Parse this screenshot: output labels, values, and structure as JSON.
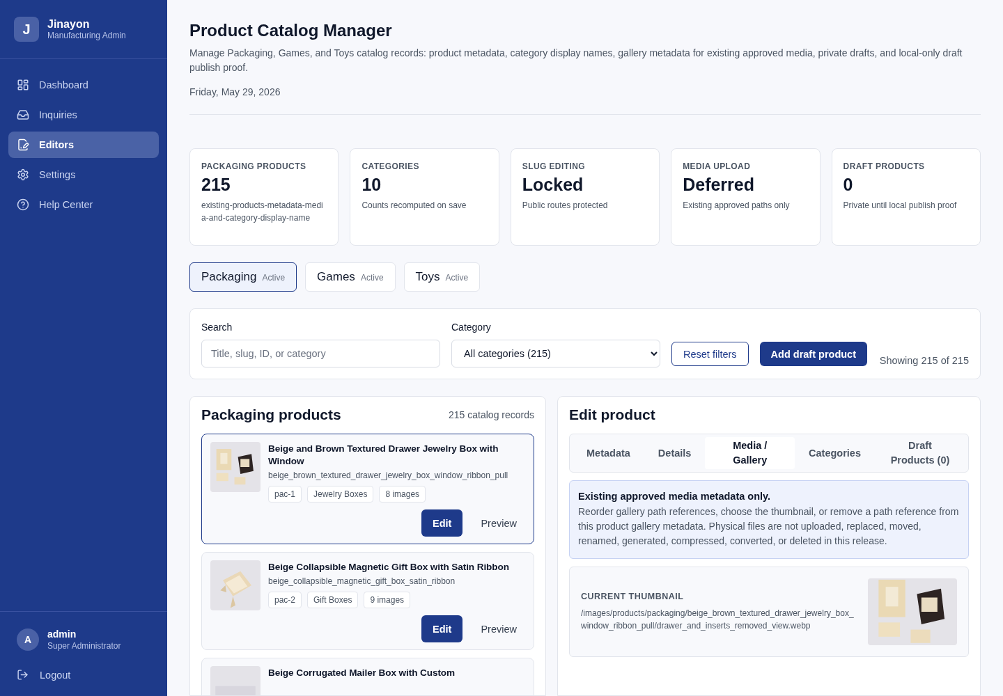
{
  "brand": {
    "initial": "J",
    "name": "Jinayon",
    "subtitle": "Manufacturing Admin"
  },
  "nav": [
    {
      "label": "Dashboard",
      "selected": false
    },
    {
      "label": "Inquiries",
      "selected": false
    },
    {
      "label": "Editors",
      "selected": true
    },
    {
      "label": "Settings",
      "selected": false
    },
    {
      "label": "Help Center",
      "selected": false
    }
  ],
  "user": {
    "initial": "A",
    "name": "admin",
    "role": "Super Administrator"
  },
  "logout": "Logout",
  "header": {
    "title": "Product Catalog Manager",
    "description": "Manage Packaging, Games, and Toys catalog records: product metadata, category display names, gallery metadata for existing approved media, private drafts, and local-only draft publish proof.",
    "date": "Friday, May 29, 2026"
  },
  "stats": [
    {
      "label": "PACKAGING PRODUCTS",
      "value": "215",
      "note": "existing-products-metadata-media-and-category-display-name"
    },
    {
      "label": "CATEGORIES",
      "value": "10",
      "note": "Counts recomputed on save"
    },
    {
      "label": "SLUG EDITING",
      "value": "Locked",
      "note": "Public routes protected"
    },
    {
      "label": "MEDIA UPLOAD",
      "value": "Deferred",
      "note": "Existing approved paths only"
    },
    {
      "label": "DRAFT PRODUCTS",
      "value": "0",
      "note": "Private until local publish proof"
    }
  ],
  "catalog_tabs": [
    {
      "label": "Packaging",
      "badge": "Active",
      "selected": true
    },
    {
      "label": "Games",
      "badge": "Active",
      "selected": false
    },
    {
      "label": "Toys",
      "badge": "Active",
      "selected": false
    }
  ],
  "filters": {
    "search_label": "Search",
    "search_placeholder": "Title, slug, ID, or category",
    "category_label": "Category",
    "category_value": "All categories (215)",
    "reset": "Reset filters",
    "add": "Add draft product",
    "showing": "Showing 215 of 215"
  },
  "products_panel": {
    "title": "Packaging products",
    "count": "215 catalog records",
    "items": [
      {
        "title": "Beige and Brown Textured Drawer Jewelry Box with Window",
        "slug": "beige_brown_textured_drawer_jewelry_box_window_ribbon_pull",
        "tags": [
          "pac-1",
          "Jewelry Boxes",
          "8 images"
        ],
        "selected": true,
        "edit": "Edit",
        "preview": "Preview"
      },
      {
        "title": "Beige Collapsible Magnetic Gift Box with Satin Ribbon",
        "slug": "beige_collapsible_magnetic_gift_box_satin_ribbon",
        "tags": [
          "pac-2",
          "Gift Boxes",
          "9 images"
        ],
        "selected": false,
        "edit": "Edit",
        "preview": "Preview"
      },
      {
        "title": "Beige Corrugated Mailer Box with Custom",
        "selected": false
      }
    ]
  },
  "edit_panel": {
    "title": "Edit product",
    "tabs": [
      {
        "label": "Metadata",
        "selected": false
      },
      {
        "label": "Details",
        "selected": false
      },
      {
        "label": "Media / Gallery",
        "selected": true
      },
      {
        "label": "Categories",
        "selected": false
      },
      {
        "label": "Draft Products (0)",
        "selected": false
      }
    ],
    "notice": {
      "title": "Existing approved media metadata only.",
      "body": "Reorder gallery path references, choose the thumbnail, or remove a path reference from this product gallery metadata. Physical files are not uploaded, replaced, moved, renamed, generated, compressed, converted, or deleted in this release."
    },
    "thumbnail": {
      "label": "CURRENT THUMBNAIL",
      "path": "/images/products/packaging/beige_brown_textured_drawer_jewelry_box_window_ribbon_pull/drawer_and_inserts_removed_view.webp"
    }
  }
}
